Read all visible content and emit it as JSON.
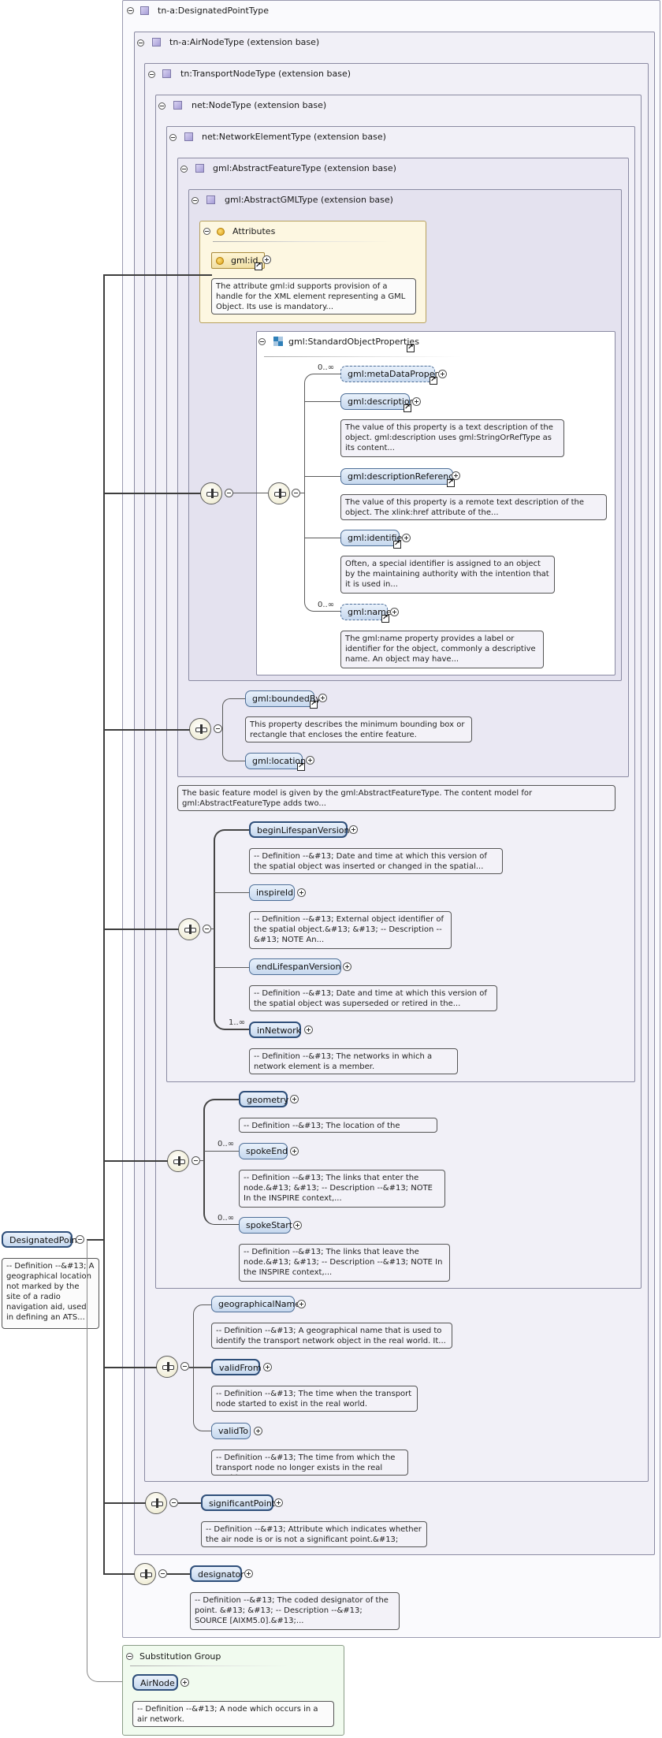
{
  "types": {
    "designated_point_type": "tn-a:DesignatedPointType",
    "air_node_type": "tn-a:AirNodeType (extension base)",
    "transport_node_type": "tn:TransportNodeType (extension base)",
    "node_type": "net:NodeType (extension base)",
    "network_element_type": "net:NetworkElementType (extension base)",
    "abstract_feature_type": "gml:AbstractFeatureType (extension base)",
    "abstract_gml_type": "gml:AbstractGMLType (extension base)"
  },
  "attributes": {
    "title": "Attributes",
    "id_label": "gml:id",
    "id_doc": "The attribute gml:id supports provision of a handle for the XML element representing a GML Object. Its use is mandatory..."
  },
  "standard_object_properties": {
    "title": "gml:StandardObjectProperties",
    "items": [
      {
        "label": "gml:metaDataProperty",
        "card": "0..∞",
        "doc": ""
      },
      {
        "label": "gml:description",
        "card": "",
        "doc": "The value of this property is a text description of the object. gml:description uses gml:StringOrRefType as its content..."
      },
      {
        "label": "gml:descriptionReference",
        "card": "",
        "doc": "The value of this property is a remote text description of the object. The xlink:href attribute of the..."
      },
      {
        "label": "gml:identifier",
        "card": "",
        "doc": "Often, a special identifier is assigned to an object by the maintaining authority with the intention that it is used in..."
      },
      {
        "label": "gml:name",
        "card": "0..∞",
        "doc": "The gml:name property provides a label or identifier for the object, commonly a descriptive name. An object may have..."
      }
    ]
  },
  "feature": {
    "bounded_by": "gml:boundedBy",
    "bounded_by_doc": "This property describes the minimum bounding box or rectangle that encloses the entire feature.",
    "location": "gml:location",
    "feature_doc": "The basic feature model is given by the gml:AbstractFeatureType. The content model for gml:AbstractFeatureType adds two..."
  },
  "network_element": {
    "items": [
      {
        "label": "beginLifespanVersion",
        "card": "",
        "doc": "-- Definition --&#13; Date and time at which this version of the spatial object was inserted or changed in the spatial..."
      },
      {
        "label": "inspireId",
        "card": "",
        "doc": "-- Definition --&#13; External object identifier of the spatial object.&#13; &#13; -- Description --&#13; NOTE An..."
      },
      {
        "label": "endLifespanVersion",
        "card": "",
        "doc": "-- Definition --&#13; Date and time at which this version of the spatial object was superseded or retired in the..."
      },
      {
        "label": "inNetwork",
        "card": "1..∞",
        "doc": "-- Definition --&#13; The networks in which a network element is a member."
      }
    ]
  },
  "node": {
    "items": [
      {
        "label": "geometry",
        "card": "",
        "doc": "-- Definition --&#13; The location of the node.&#13;"
      },
      {
        "label": "spokeEnd",
        "card": "0..∞",
        "doc": "-- Definition --&#13; The links that enter the node.&#13; &#13; -- Description --&#13; NOTE In the INSPIRE context,..."
      },
      {
        "label": "spokeStart",
        "card": "0..∞",
        "doc": "-- Definition --&#13; The links that leave the node.&#13; &#13; -- Description --&#13; NOTE In the INSPIRE context,..."
      }
    ]
  },
  "transport_node": {
    "items": [
      {
        "label": "geographicalName",
        "doc": "-- Definition --&#13; A geographical name that is used to identify the transport network object in the real world. It..."
      },
      {
        "label": "validFrom",
        "doc": "-- Definition --&#13; The time when the transport node started to exist in the real world."
      },
      {
        "label": "validTo",
        "doc": "-- Definition --&#13; The time from which the transport node no longer exists in the real world."
      }
    ]
  },
  "air_node": {
    "label": "significantPoint",
    "doc": "-- Definition --&#13; Attribute which indicates whether the air node is or is not a significant point.&#13; &#13;..."
  },
  "designated_point": {
    "label": "DesignatedPoint",
    "doc": "-- Definition --&#13; A geographical location not marked by the site of a radio navigation aid, used in defining an ATS...",
    "designator": "designator",
    "designator_doc": "-- Definition --&#13; The coded designator of the point. &#13; &#13; -- Description --&#13; SOURCE [AIXM5.0].&#13;..."
  },
  "substitution": {
    "title": "Substitution Group",
    "label": "AirNode",
    "doc": "-- Definition --&#13; A node which occurs in a air network."
  }
}
